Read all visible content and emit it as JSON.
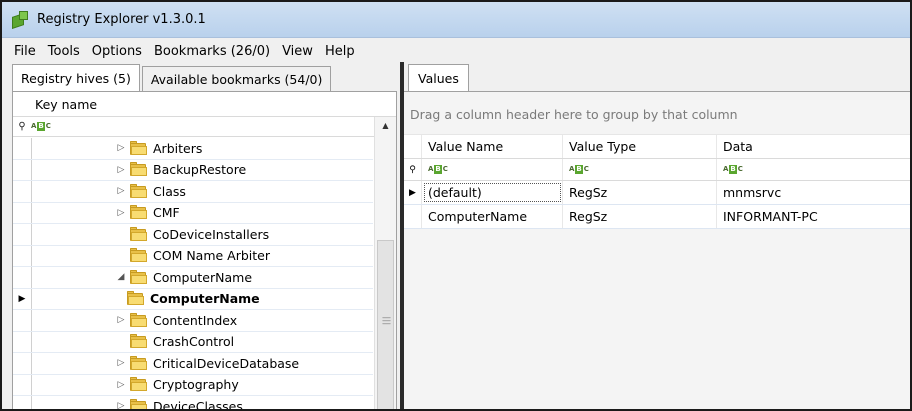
{
  "window": {
    "title": "Registry Explorer v1.3.0.1"
  },
  "menu": [
    "File",
    "Tools",
    "Options",
    "Bookmarks (26/0)",
    "View",
    "Help"
  ],
  "left_tabs": [
    {
      "label": "Registry hives (5)",
      "active": true
    },
    {
      "label": "Available bookmarks (54/0)",
      "active": false
    }
  ],
  "tree": {
    "column_header": "Key name",
    "filter_icon": "abc-filter-icon",
    "rows": [
      {
        "label": "Arbiters",
        "expandable": true,
        "expanded": false,
        "selected": false
      },
      {
        "label": "BackupRestore",
        "expandable": true,
        "expanded": false,
        "selected": false
      },
      {
        "label": "Class",
        "expandable": true,
        "expanded": false,
        "selected": false
      },
      {
        "label": "CMF",
        "expandable": true,
        "expanded": false,
        "selected": false
      },
      {
        "label": "CoDeviceInstallers",
        "expandable": false,
        "expanded": false,
        "selected": false
      },
      {
        "label": "COM Name Arbiter",
        "expandable": false,
        "expanded": false,
        "selected": false
      },
      {
        "label": "ComputerName",
        "expandable": true,
        "expanded": true,
        "selected": false
      },
      {
        "label": "ComputerName",
        "expandable": false,
        "expanded": false,
        "selected": true
      },
      {
        "label": "ContentIndex",
        "expandable": true,
        "expanded": false,
        "selected": false
      },
      {
        "label": "CrashControl",
        "expandable": false,
        "expanded": false,
        "selected": false
      },
      {
        "label": "CriticalDeviceDatabase",
        "expandable": true,
        "expanded": false,
        "selected": false
      },
      {
        "label": "Cryptography",
        "expandable": true,
        "expanded": false,
        "selected": false
      },
      {
        "label": "DeviceClasses",
        "expandable": true,
        "expanded": false,
        "selected": false
      }
    ]
  },
  "right_tabs": [
    {
      "label": "Values",
      "active": true
    }
  ],
  "values": {
    "group_hint": "Drag a column header here to group by that column",
    "columns": [
      "Value Name",
      "Value Type",
      "Data"
    ],
    "rows": [
      {
        "name": "(default)",
        "type": "RegSz",
        "data": "mnmsrvc"
      },
      {
        "name": "ComputerName",
        "type": "RegSz",
        "data": "INFORMANT-PC"
      }
    ]
  },
  "colors": {
    "titlebar": "#c4d9f0",
    "folder": "#f8dc72",
    "row_separator": "#dde6f2"
  }
}
